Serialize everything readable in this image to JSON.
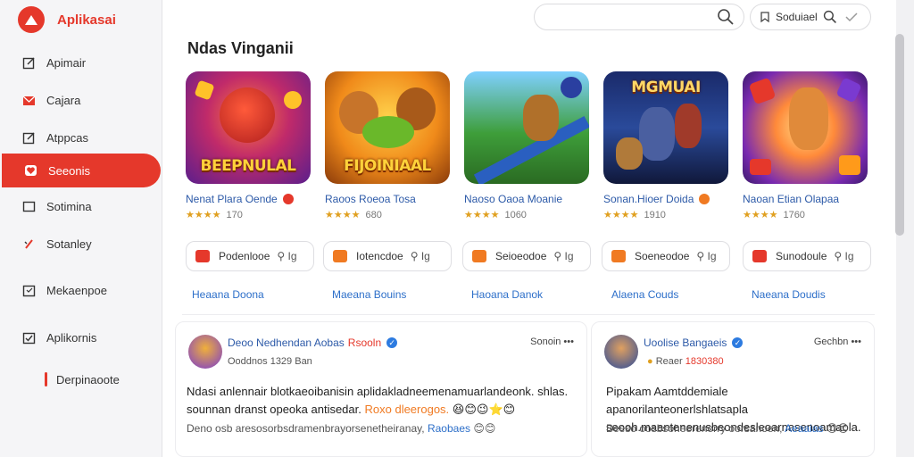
{
  "app": {
    "name": "Aplikasai",
    "brand_color": "#e5382b"
  },
  "sidebar": {
    "items": [
      {
        "label": "Apimair",
        "icon": "edit-icon"
      },
      {
        "label": "Cajara",
        "icon": "mail-icon"
      },
      {
        "label": "Atppcas",
        "icon": "edit-icon"
      },
      {
        "label": "Seeonis",
        "icon": "heart-icon",
        "active": true
      },
      {
        "label": "Sotimina",
        "icon": "square-icon"
      },
      {
        "label": "Sotanley",
        "icon": "heart-icon"
      },
      {
        "label": "Mekaenpoe",
        "icon": "calendar-icon"
      },
      {
        "label": "Aplikornis",
        "icon": "checkbox-icon"
      },
      {
        "label": "Derpinaoote",
        "icon": "sub-marker"
      }
    ]
  },
  "header": {
    "search_placeholder": "",
    "filter_label": "Soduiael"
  },
  "section": {
    "title": "Ndas Vinganii"
  },
  "apps": [
    {
      "banner": "BEEPNULAL",
      "title": "Nenat Plara Oende",
      "rating": "★★★★",
      "reviews": "170",
      "action": "Podenlooe",
      "link": "Heaana Doona"
    },
    {
      "banner": "FIJOINIAAL",
      "title": "Raoos Roeoa Tosa",
      "rating": "★★★★",
      "reviews": "680",
      "action": "Iotencdoe",
      "link": "Maeana Bouins"
    },
    {
      "banner": "",
      "title": "Naoso Oaoa Moanie",
      "rating": "★★★★",
      "reviews": "1060",
      "action": "Seioeodoe",
      "link": "Haoana Danok"
    },
    {
      "banner": "MGMUAI",
      "title": "Sonan.Hioer Doida",
      "rating": "★★★★",
      "reviews": "1910",
      "action": "Soeneodoe",
      "link": "Alaena Couds"
    },
    {
      "banner": "",
      "title": "Naoan Etian Olapaa",
      "rating": "★★★★",
      "reviews": "1760",
      "action": "Sunodoule",
      "link": "Naeana Doudis"
    }
  ],
  "posts": [
    {
      "name": "Deoo Nedhendan Aobas",
      "name_tag": "Rsooln",
      "meta": "Ooddnos 1329 Ban",
      "more": "Sonoin •••",
      "line1": "Ndasi anlennair blotkaeoibanisin aplidakladneemenamuarlandeonk. shlas.",
      "line2": "sounnan dranst opeoka antisedar.",
      "line2_orange": "Roxo dleerogos.",
      "foot": "Deno osb aresosorbsdramenbrayorsenetheiranay,",
      "foot_blue": "Raobaes"
    },
    {
      "name": "Uoolise Bangaeis",
      "name_tag": "",
      "meta": "Reaer 1830380",
      "more": "Gechbn •••",
      "line1": "Pipakam Aamtddemiale apanorilanteonerlshlatsapla",
      "line2": "seooh.maantenenusbeondesleoarnasenoamaola.",
      "line2_orange": "",
      "foot": "Beeso oosbsoheerenorry oorsanoen,",
      "foot_blue": "Aeaaias"
    }
  ]
}
